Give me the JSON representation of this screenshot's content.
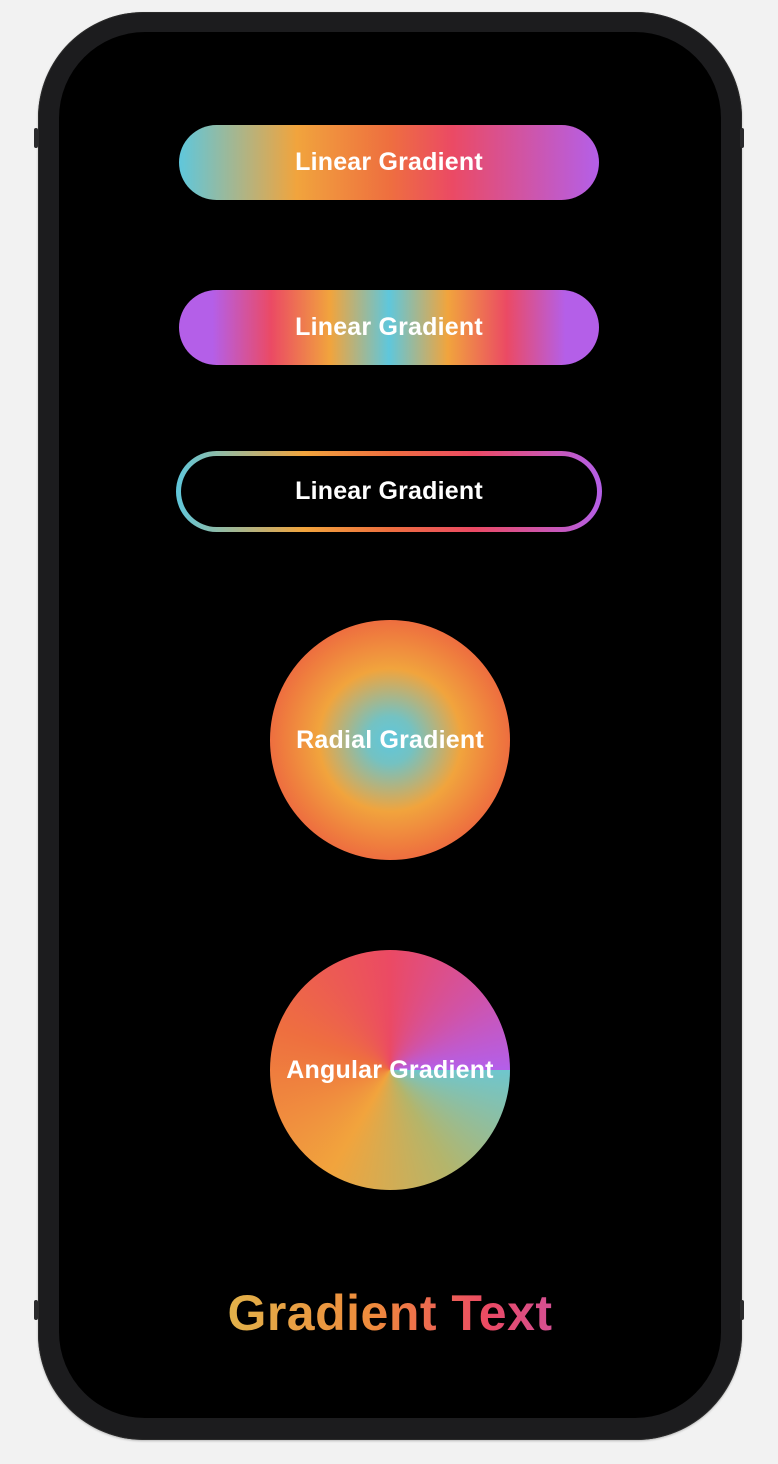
{
  "buttons": {
    "linear_label": "Linear Gradient",
    "linear_symmetric_label": "Linear Gradient",
    "linear_outline_label": "Linear Gradient",
    "radial_label": "Radial Gradient",
    "angular_label": "Angular Gradient"
  },
  "gradient_text": "Gradient Text",
  "colors": {
    "screen_background": "#000000",
    "frame": "#1c1c1e",
    "page_background": "#f2f2f2",
    "gradient_cyan": "#5fc7dc",
    "gradient_orange": "#f1a43d",
    "gradient_red": "#eb4a64",
    "gradient_purple": "#b45fe8",
    "label_text": "#ffffff"
  }
}
